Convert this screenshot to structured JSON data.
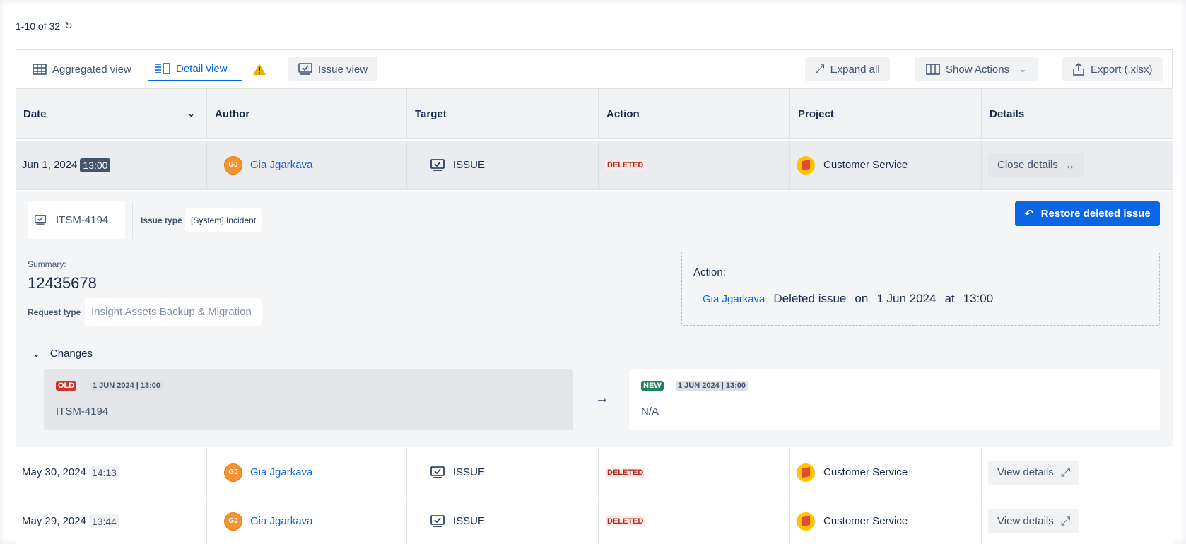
{
  "pager": {
    "text": "1-10 of 32"
  },
  "toolbar": {
    "aggregated_label": "Aggregated view",
    "detail_label": "Detail view",
    "issue_view_label": "Issue view",
    "expand_all_label": "Expand all",
    "show_actions_label": "Show Actions",
    "export_label": "Export (.xlsx)"
  },
  "columns": [
    "Date",
    "Author",
    "Target",
    "Action",
    "Project",
    "Details"
  ],
  "rows": [
    {
      "date": "Jun 1, 2024",
      "time": "13:00",
      "initials": "GJ",
      "author": "Gia Jgarkava",
      "target": "ISSUE",
      "action": "DELETED",
      "project": "Customer Service",
      "details": "Close details"
    },
    {
      "date": "May 30, 2024",
      "time": "14:13",
      "initials": "GJ",
      "author": "Gia Jgarkava",
      "target": "ISSUE",
      "action": "DELETED",
      "project": "Customer Service",
      "details": "View details"
    },
    {
      "date": "May 29, 2024",
      "time": "13:44",
      "initials": "GJ",
      "author": "Gia Jgarkava",
      "target": "ISSUE",
      "action": "DELETED",
      "project": "Customer Service",
      "details": "View details"
    }
  ],
  "detail": {
    "issue_key": "ITSM-4194",
    "issue_type_label": "Issue type",
    "issue_type": "[System] Incident",
    "restore_label": "Restore deleted issue",
    "summary_label": "Summary:",
    "summary": "12435678",
    "request_type_label": "Request type",
    "request_type": "Insight Assets Backup & Migration",
    "action_label": "Action:",
    "action_author": "Gia Jgarkava",
    "action_verb": "Deleted issue",
    "action_on": "on",
    "action_date": "1 Jun 2024",
    "action_at": "at",
    "action_time": "13:00",
    "changes_label": "Changes",
    "old_badge": "OLD",
    "old_date": "1 JUN 2024 | 13:00",
    "old_value": "ITSM-4194",
    "new_badge": "NEW",
    "new_date": "1 JUN 2024 | 13:00",
    "new_value": "N/A"
  },
  "colors": {
    "primary": "#0c66e4",
    "deleted": "#ae2e24",
    "old": "#c9372c",
    "new": "#1f845a",
    "avatar": "#f79232"
  }
}
